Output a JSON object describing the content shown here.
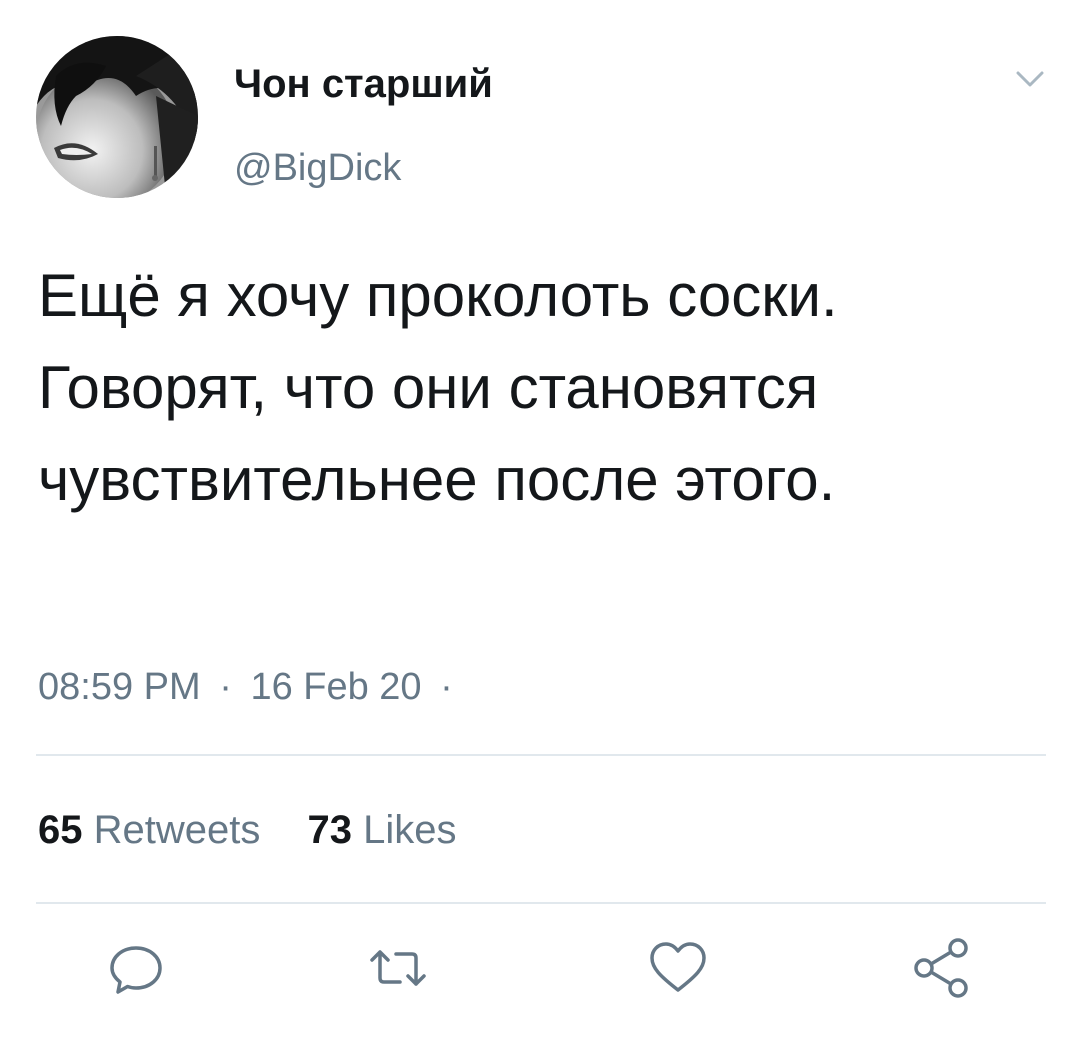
{
  "user": {
    "display_name": "Чон старший",
    "handle": "@BigDick"
  },
  "tweet": {
    "text": "Ещё я хочу проколоть соски. Говорят, что они становятся чувствительнее после этого.",
    "time": "08:59 PM",
    "date": "16 Feb 20",
    "separator": "·"
  },
  "stats": {
    "retweets_count": "65",
    "retweets_label": "Retweets",
    "likes_count": "73",
    "likes_label": "Likes"
  },
  "icons": {
    "more": "chevron-down-icon",
    "reply": "reply-icon",
    "retweet": "retweet-icon",
    "like": "heart-icon",
    "share": "share-icon"
  },
  "colors": {
    "text_primary": "#14171a",
    "text_secondary": "#657786",
    "divider": "#e1e8ed",
    "icon": "#657786"
  }
}
